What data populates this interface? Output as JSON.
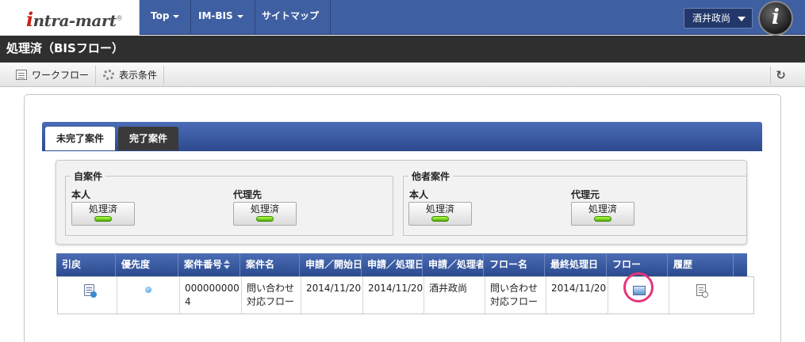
{
  "header": {
    "logo_prefix": "i",
    "logo_text": "ntra-mart",
    "logo_mark": "®",
    "nav": [
      {
        "label": "Top"
      },
      {
        "label": "IM-BIS"
      },
      {
        "label": "サイトマップ"
      }
    ],
    "user_name": "酒井政尚",
    "avatar_letter": "i"
  },
  "page_title": "処理済（BISフロー）",
  "toolbar": {
    "workflow_label": "ワークフロー",
    "conditions_label": "表示条件",
    "refresh_icon": "↻"
  },
  "tabs": [
    {
      "label": "未完了案件",
      "active": true
    },
    {
      "label": "完了案件",
      "active": false
    }
  ],
  "filters": {
    "own": {
      "legend": "自案件",
      "self_label": "本人",
      "self_button": "処理済",
      "proxy_label": "代理先",
      "proxy_button": "処理済"
    },
    "others": {
      "legend": "他者案件",
      "self_label": "本人",
      "self_button": "処理済",
      "proxy_label": "代理元",
      "proxy_button": "処理済"
    }
  },
  "table": {
    "columns": [
      "引戻",
      "優先度",
      "案件番号",
      "案件名",
      "申請／開始日",
      "申請／処理日",
      "申請／処理者",
      "フロー名",
      "最終処理日",
      "フロー",
      "履歴"
    ],
    "rows": [
      {
        "case_number_line1": "000000000",
        "case_number_line2": "4",
        "case_name_line1": "問い合わせ",
        "case_name_line2": "対応フロー",
        "start_date": "2014/11/20",
        "process_date": "2014/11/20",
        "processor": "酒井政尚",
        "flow_name_line1": "問い合わせ",
        "flow_name_line2": "対応フロー",
        "last_date": "2014/11/20"
      }
    ]
  }
}
